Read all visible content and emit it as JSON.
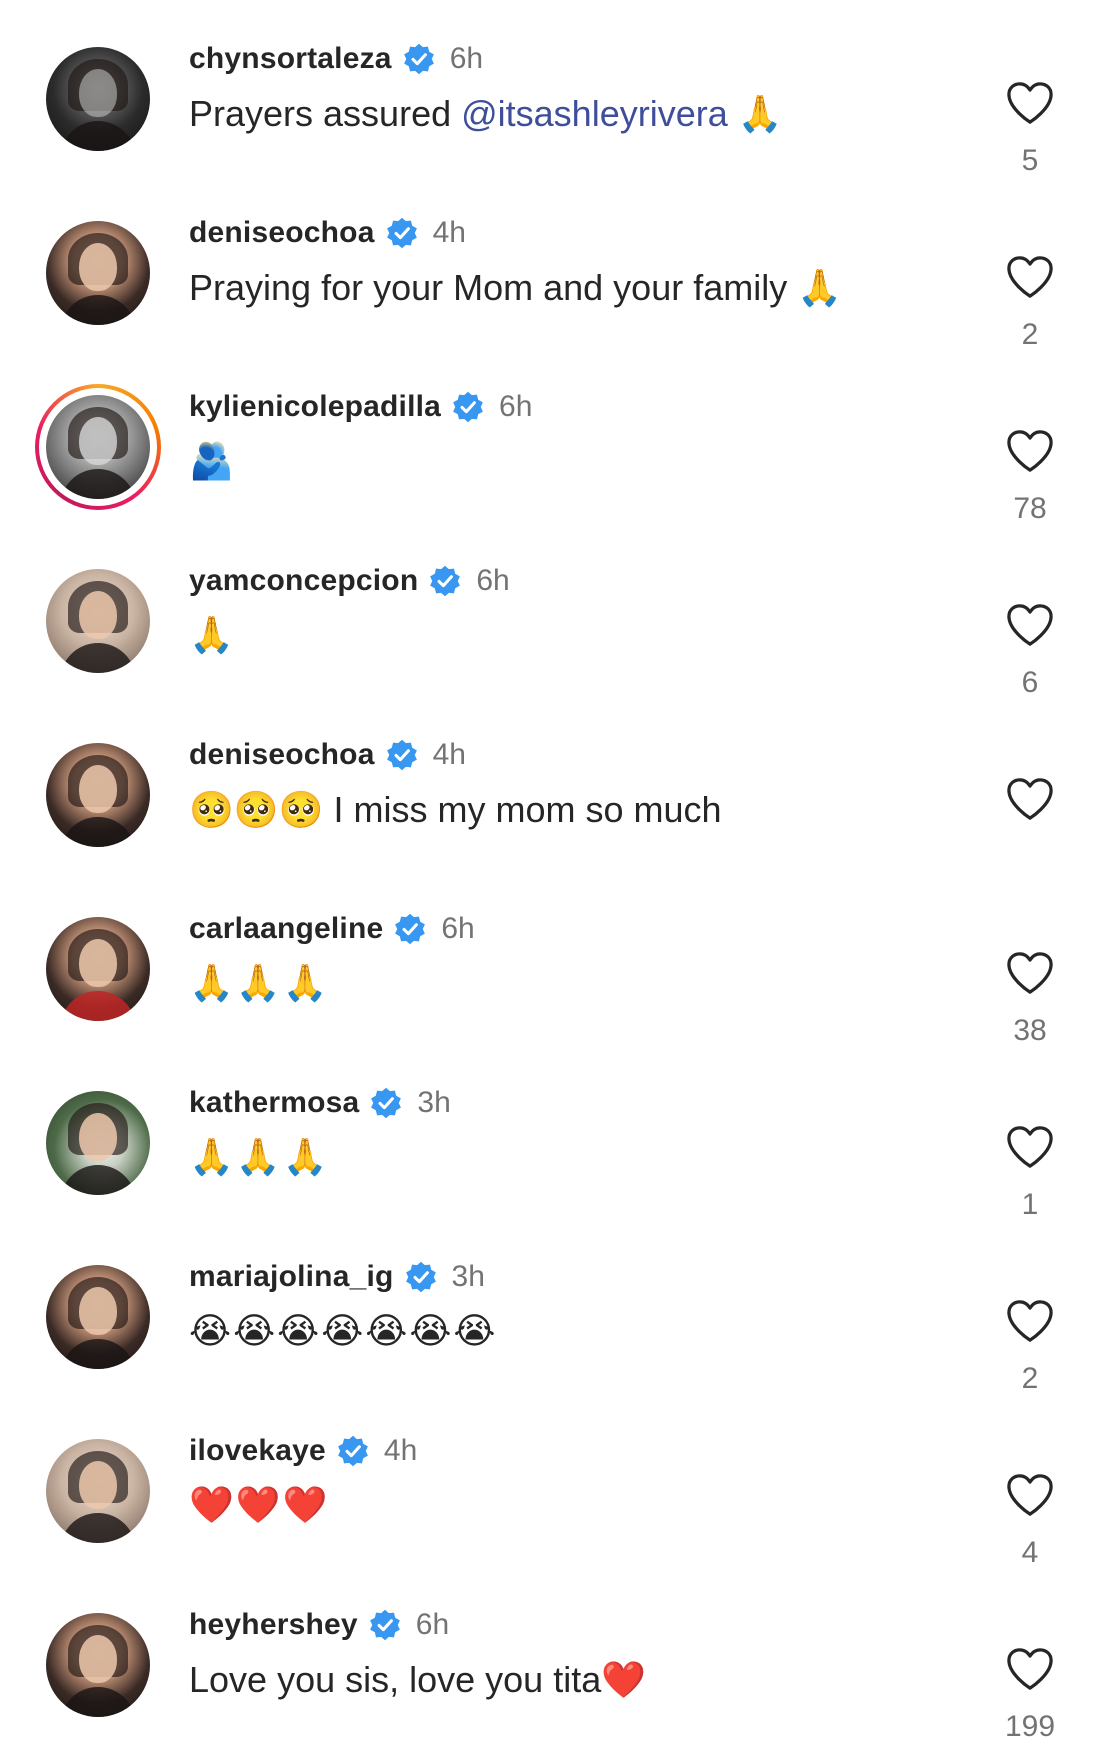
{
  "colors": {
    "verified_badge": "#3897f0",
    "mention": "#3f4e9b",
    "timestamp": "#737373",
    "like_count": "#737373",
    "story_ring": [
      "#f9a825",
      "#e91e63"
    ]
  },
  "comments": [
    {
      "username": "chynsortaleza",
      "verified": true,
      "time": "6h",
      "text_before": "Prayers assured ",
      "mention": "@itsashleyrivera",
      "text_after": " 🙏",
      "likes": "5",
      "icons": [
        "verified-badge-icon",
        "heart-icon"
      ]
    },
    {
      "username": "deniseochoa",
      "verified": true,
      "time": "4h",
      "text_before": "Praying for your Mom and your family 🙏",
      "mention": "",
      "text_after": "",
      "likes": "2",
      "icons": [
        "verified-badge-icon",
        "heart-icon"
      ]
    },
    {
      "username": "kylienicolepadilla",
      "verified": true,
      "time": "6h",
      "text_before": "🫂",
      "mention": "",
      "text_after": "",
      "likes": "78",
      "has_story_ring": true,
      "icons": [
        "verified-badge-icon",
        "heart-icon"
      ]
    },
    {
      "username": "yamconcepcion",
      "verified": true,
      "time": "6h",
      "text_before": "🙏",
      "mention": "",
      "text_after": "",
      "likes": "6",
      "icons": [
        "verified-badge-icon",
        "heart-icon"
      ]
    },
    {
      "username": "deniseochoa",
      "verified": true,
      "time": "4h",
      "text_before": "🥺🥺🥺 I miss my mom so much",
      "mention": "",
      "text_after": "",
      "likes": "",
      "icons": [
        "verified-badge-icon",
        "heart-icon"
      ]
    },
    {
      "username": "carlaangeline",
      "verified": true,
      "time": "6h",
      "text_before": "🙏🙏🙏",
      "mention": "",
      "text_after": "",
      "likes": "38",
      "icons": [
        "verified-badge-icon",
        "heart-icon"
      ]
    },
    {
      "username": "kathermosa",
      "verified": true,
      "time": "3h",
      "text_before": "🙏🙏🙏",
      "mention": "",
      "text_after": "",
      "likes": "1",
      "icons": [
        "verified-badge-icon",
        "heart-icon"
      ]
    },
    {
      "username": "mariajolina_ig",
      "verified": true,
      "time": "3h",
      "text_before": "😭😭😭😭😭😭😭",
      "mention": "",
      "text_after": "",
      "likes": "2",
      "icons": [
        "verified-badge-icon",
        "heart-icon"
      ]
    },
    {
      "username": "ilovekaye",
      "verified": true,
      "time": "4h",
      "text_before": "❤️❤️❤️",
      "mention": "",
      "text_after": "",
      "likes": "4",
      "icons": [
        "verified-badge-icon",
        "heart-icon"
      ]
    },
    {
      "username": "heyhershey",
      "verified": true,
      "time": "6h",
      "text_before": "Love you sis, love you tita❤️",
      "mention": "",
      "text_after": "",
      "likes": "199",
      "icons": [
        "verified-badge-icon",
        "heart-icon"
      ]
    }
  ]
}
